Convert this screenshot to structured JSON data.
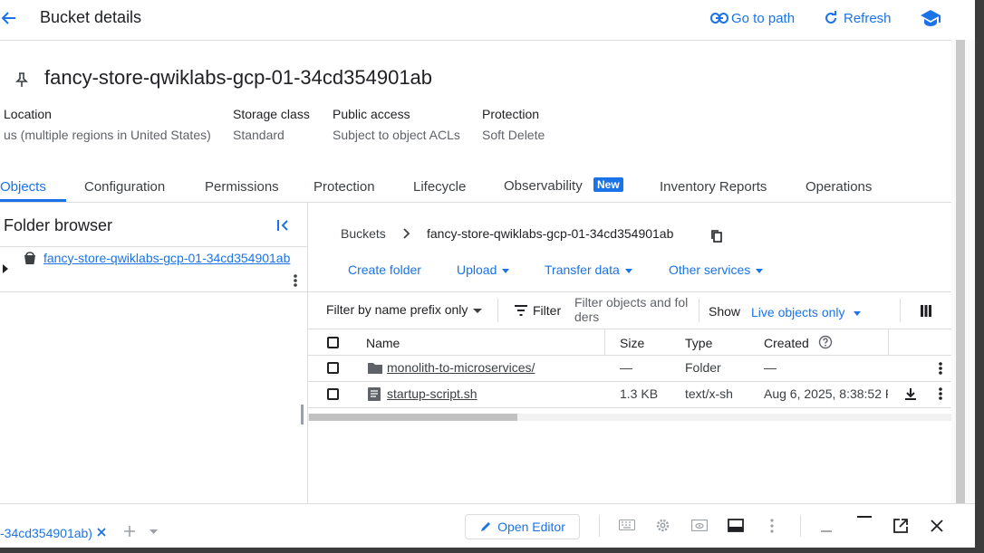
{
  "header": {
    "title": "Bucket details",
    "go_to_path": "Go to path",
    "refresh": "Refresh"
  },
  "bucket": {
    "name": "fancy-store-qwiklabs-gcp-01-34cd354901ab",
    "info": [
      {
        "label": "Location",
        "value": "us (multiple regions in United States)"
      },
      {
        "label": "Storage class",
        "value": "Standard"
      },
      {
        "label": "Public access",
        "value": "Subject to object ACLs"
      },
      {
        "label": "Protection",
        "value": "Soft Delete"
      }
    ]
  },
  "tabs": {
    "items": [
      "Objects",
      "Configuration",
      "Permissions",
      "Protection",
      "Lifecycle",
      "Observability",
      "Inventory Reports",
      "Operations"
    ],
    "active": "Objects",
    "new_badge": "New"
  },
  "folder_browser": {
    "title": "Folder browser",
    "tree_item": "fancy-store-qwiklabs-gcp-01-34cd354901ab"
  },
  "breadcrumb": {
    "root": "Buckets",
    "current": "fancy-store-qwiklabs-gcp-01-34cd354901ab"
  },
  "actions": {
    "create_folder": "Create folder",
    "upload": "Upload",
    "transfer_data": "Transfer data",
    "other_services": "Other services"
  },
  "filter_bar": {
    "prefix_select": "Filter by name prefix only",
    "filter_label": "Filter",
    "filter_placeholder_line1": "Filter objects and fol",
    "filter_placeholder_line2": "ders",
    "show_label": "Show",
    "show_value": "Live objects only"
  },
  "table": {
    "columns": {
      "name": "Name",
      "size": "Size",
      "type": "Type",
      "created": "Created"
    },
    "rows": [
      {
        "name": "monolith-to-microservices/",
        "size": "—",
        "type": "Folder",
        "created": "—"
      },
      {
        "name": "startup-script.sh",
        "size": "1.3 KB",
        "type": "text/x-sh",
        "created": "Aug 6, 2025, 8:38:52 P"
      }
    ]
  },
  "bottom": {
    "tab_label": "-34cd354901ab)",
    "open_editor": "Open Editor"
  },
  "colors": {
    "accent": "#1a73e8",
    "badge": "#1a73e8",
    "divider": "#dadce0"
  }
}
